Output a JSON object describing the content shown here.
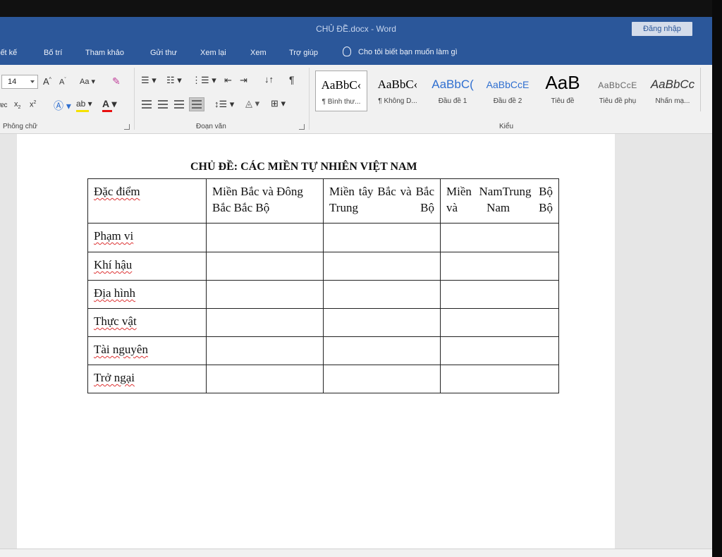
{
  "window": {
    "title": "CHỦ ĐỀ.docx - Word",
    "login_label": "Đăng nhập"
  },
  "tabs": [
    "iết kế",
    "Bố trí",
    "Tham khảo",
    "Gửi thư",
    "Xem lại",
    "Xem",
    "Trợ giúp"
  ],
  "tell_me": "Cho tôi biết bạn muốn làm gì",
  "ribbon": {
    "font_size": "14",
    "change_case": "Aa",
    "group_font": "Phông chữ",
    "group_paragraph": "Đoạn văn",
    "group_styles": "Kiểu",
    "styles": [
      {
        "sample": "AaBbC‹",
        "name": "¶ Bình thư..."
      },
      {
        "sample": "AaBbC‹",
        "name": "¶ Không D..."
      },
      {
        "sample": "AaBbC(",
        "name": "Đầu đề 1"
      },
      {
        "sample": "AaBbCcE",
        "name": "Đầu đề 2"
      },
      {
        "sample": "AaB",
        "name": "Tiêu đề"
      },
      {
        "sample": "AaBbCcE",
        "name": "Tiêu đề phụ"
      },
      {
        "sample": "AaBbCc",
        "name": "Nhấn mạ..."
      }
    ]
  },
  "colors": {
    "brand": "#2b579a",
    "highlight": "#f5e100",
    "font_color": "#e81010"
  },
  "document": {
    "title": "CHỦ ĐỀ: CÁC MIỀN TỰ NHIÊN VIỆT NAM",
    "table": {
      "headers": [
        "Đặc điểm",
        "Miền Bắc và Đông Bắc Bắc Bộ",
        "Miền tây Bắc và Bắc Trung Bộ",
        "Miền NamTrung Bộ và Nam Bộ"
      ],
      "rows": [
        "Phạm vi",
        "Khí hậu",
        "Địa hình",
        "Thực vật",
        "Tài nguyên",
        "Trở ngại"
      ]
    }
  }
}
